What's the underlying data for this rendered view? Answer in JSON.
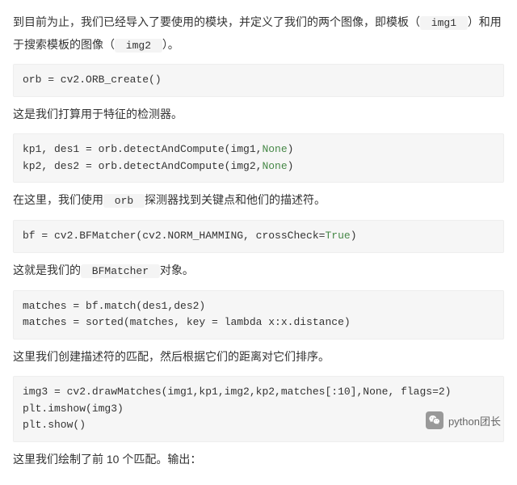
{
  "para1_a": "   到目前为止，我们已经导入了要使用的模块，并定义了我们的两个图像，即模板（",
  "code_img1": " img1 ",
  "para1_b": "）和用于搜索模板的图像（",
  "code_img2": " img2 ",
  "para1_c": "）。",
  "code1": "orb = cv2.ORB_create()",
  "para2": "   这是我们打算用于特征的检测器。",
  "code2_l1_a": "kp1, des1 = orb.detectAndCompute(img1,",
  "code2_l1_b": "None",
  "code2_l1_c": ")",
  "code2_l2_a": "kp2, des2 = orb.detectAndCompute(img2,",
  "code2_l2_b": "None",
  "code2_l2_c": ")",
  "para3_a": "   在这里，我们使用",
  "code_orb": " orb ",
  "para3_b": "探测器找到关键点和他们的描述符。",
  "code3_a": "bf = cv2.BFMatcher(cv2.NORM_HAMMING, crossCheck=",
  "code3_b": "True",
  "code3_c": ")",
  "para4_a": "   这就是我们的",
  "code_bfm": " BFMatcher ",
  "para4_b": "对象。",
  "code4": "matches = bf.match(des1,des2)\nmatches = sorted(matches, key = lambda x:x.distance)",
  "para5": "   这里我们创建描述符的匹配，然后根据它们的距离对它们排序。",
  "code5": "img3 = cv2.drawMatches(img1,kp1,img2,kp2,matches[:10],None, flags=2)\nplt.imshow(img3)\nplt.show()",
  "para6": "   这里我们绘制了前 10 个匹配。输出：",
  "footer": "python团长"
}
